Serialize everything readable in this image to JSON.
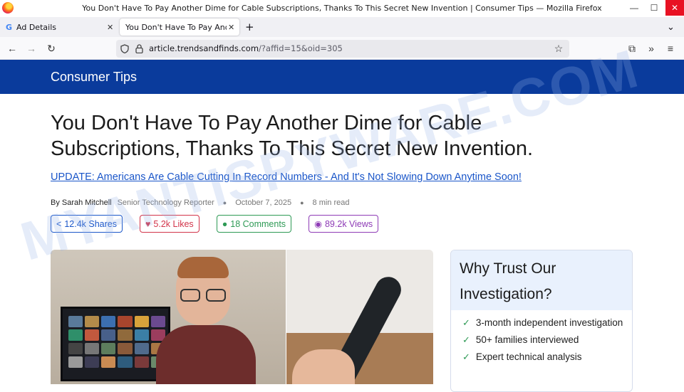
{
  "window": {
    "title": "You Don't Have To Pay Another Dime for Cable Subscriptions, Thanks To This Secret New Invention | Consumer Tips — Mozilla Firefox",
    "controls": {
      "minimize": "—",
      "maximize": "☐",
      "close": "✕"
    }
  },
  "tabs": [
    {
      "label": "Ad Details",
      "favicon": "G",
      "close": "✕"
    },
    {
      "label": "You Don't Have To Pay Anoth",
      "close": "✕"
    }
  ],
  "new_tab": "+",
  "tab_list": "⌄",
  "nav": {
    "back": "←",
    "forward": "→",
    "reload": "↻",
    "url_domain": "article.trendsandfinds.com",
    "url_path": "/?affid=15&oid=305",
    "bookmark": "☆",
    "extensions": "⧉",
    "overflow": "»",
    "menu": "≡"
  },
  "site": {
    "name": "Consumer Tips"
  },
  "article": {
    "headline": "You Don't Have To Pay Another Dime for Cable Subscriptions, Thanks To This Secret New Invention.",
    "update": "UPDATE: Americans Are Cable Cutting In Record Numbers - And It's Not Slowing Down Anytime Soon!",
    "author": "By Sarah Mitchell",
    "role": "Senior Technology Reporter",
    "date": "October 7, 2025",
    "read_time": "8 min read"
  },
  "stats": [
    {
      "icon": "<",
      "label": "12.4k Shares",
      "color": "#1a56c9"
    },
    {
      "icon": "♥",
      "label": "5.2k Likes",
      "color": "#d2344a"
    },
    {
      "icon": "●",
      "label": "18 Comments",
      "color": "#2e9a55"
    },
    {
      "icon": "◉",
      "label": "89.2k Views",
      "color": "#8e3bb6"
    }
  ],
  "trust": {
    "title": "Why Trust Our Investigation?",
    "check": "✓",
    "items": [
      "3-month independent investigation",
      "50+ families interviewed",
      "Expert technical analysis"
    ]
  },
  "watermark": "MYANTISPYWARE.COM",
  "colors": {
    "header": "#0a3b9c",
    "link": "#1a56c9",
    "trust_bg": "#e9f1fd"
  }
}
